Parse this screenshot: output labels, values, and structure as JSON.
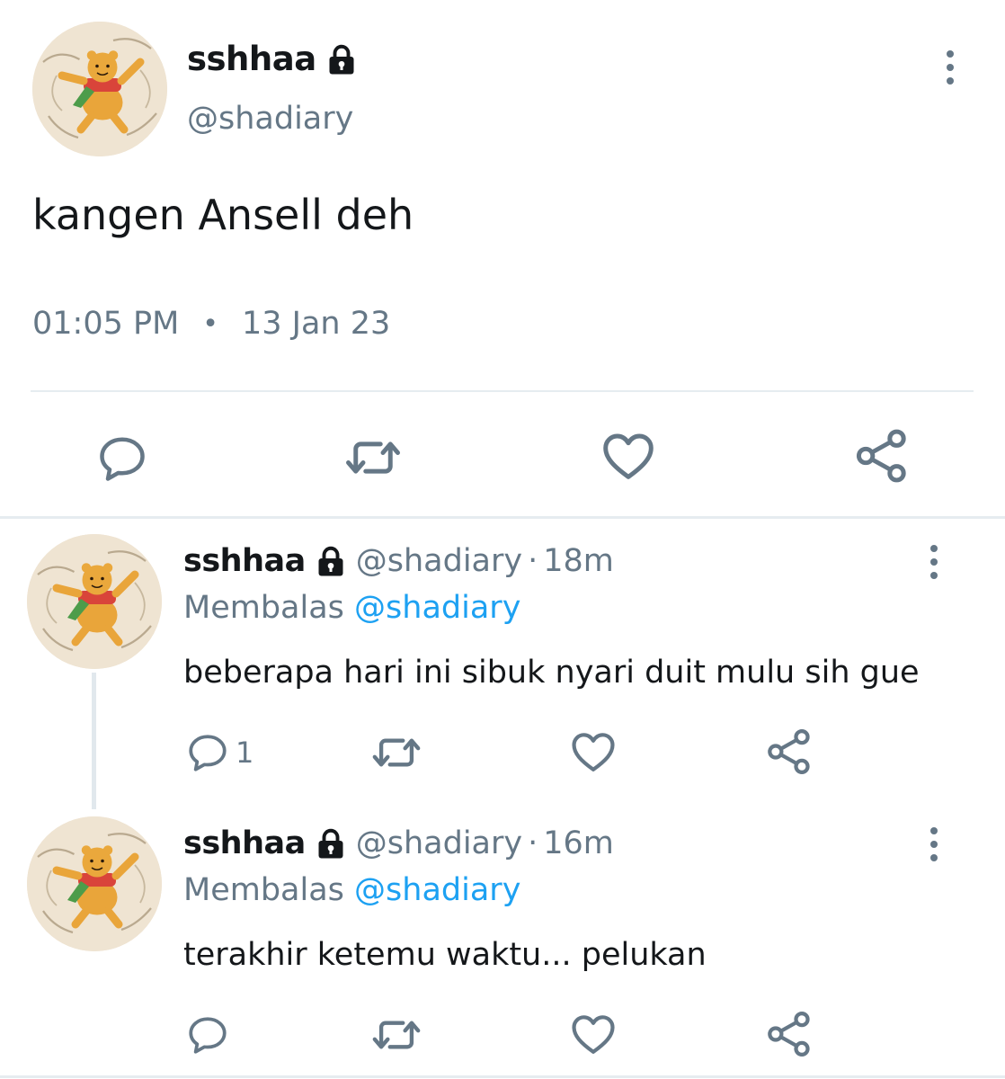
{
  "main_tweet": {
    "name": "sshhaa",
    "handle": "@shadiary",
    "text": "kangen Ansell deh",
    "time": "01:05 PM",
    "separator": "•",
    "date": "13 Jan 23"
  },
  "replies": [
    {
      "name": "sshhaa",
      "handle": "@shadiary",
      "sep": "·",
      "time": "18m",
      "replying_label": "Membalas",
      "replying_to": "@shadiary",
      "text": "beberapa hari ini sibuk nyari duit mulu sih gue",
      "reply_count": "1"
    },
    {
      "name": "sshhaa",
      "handle": "@shadiary",
      "sep": "·",
      "time": "16m",
      "replying_label": "Membalas",
      "replying_to": "@shadiary",
      "text": "terakhir ketemu waktu... pelukan",
      "reply_count": ""
    }
  ],
  "icons": {
    "lock": "lock-icon",
    "more": "more-vertical-icon",
    "reply": "reply-icon",
    "retweet": "retweet-icon",
    "like": "heart-icon",
    "share": "share-icon"
  },
  "colors": {
    "text": "#14171a",
    "secondary": "#657786",
    "mention": "#1da1f2",
    "divider": "#e6ecf0"
  }
}
